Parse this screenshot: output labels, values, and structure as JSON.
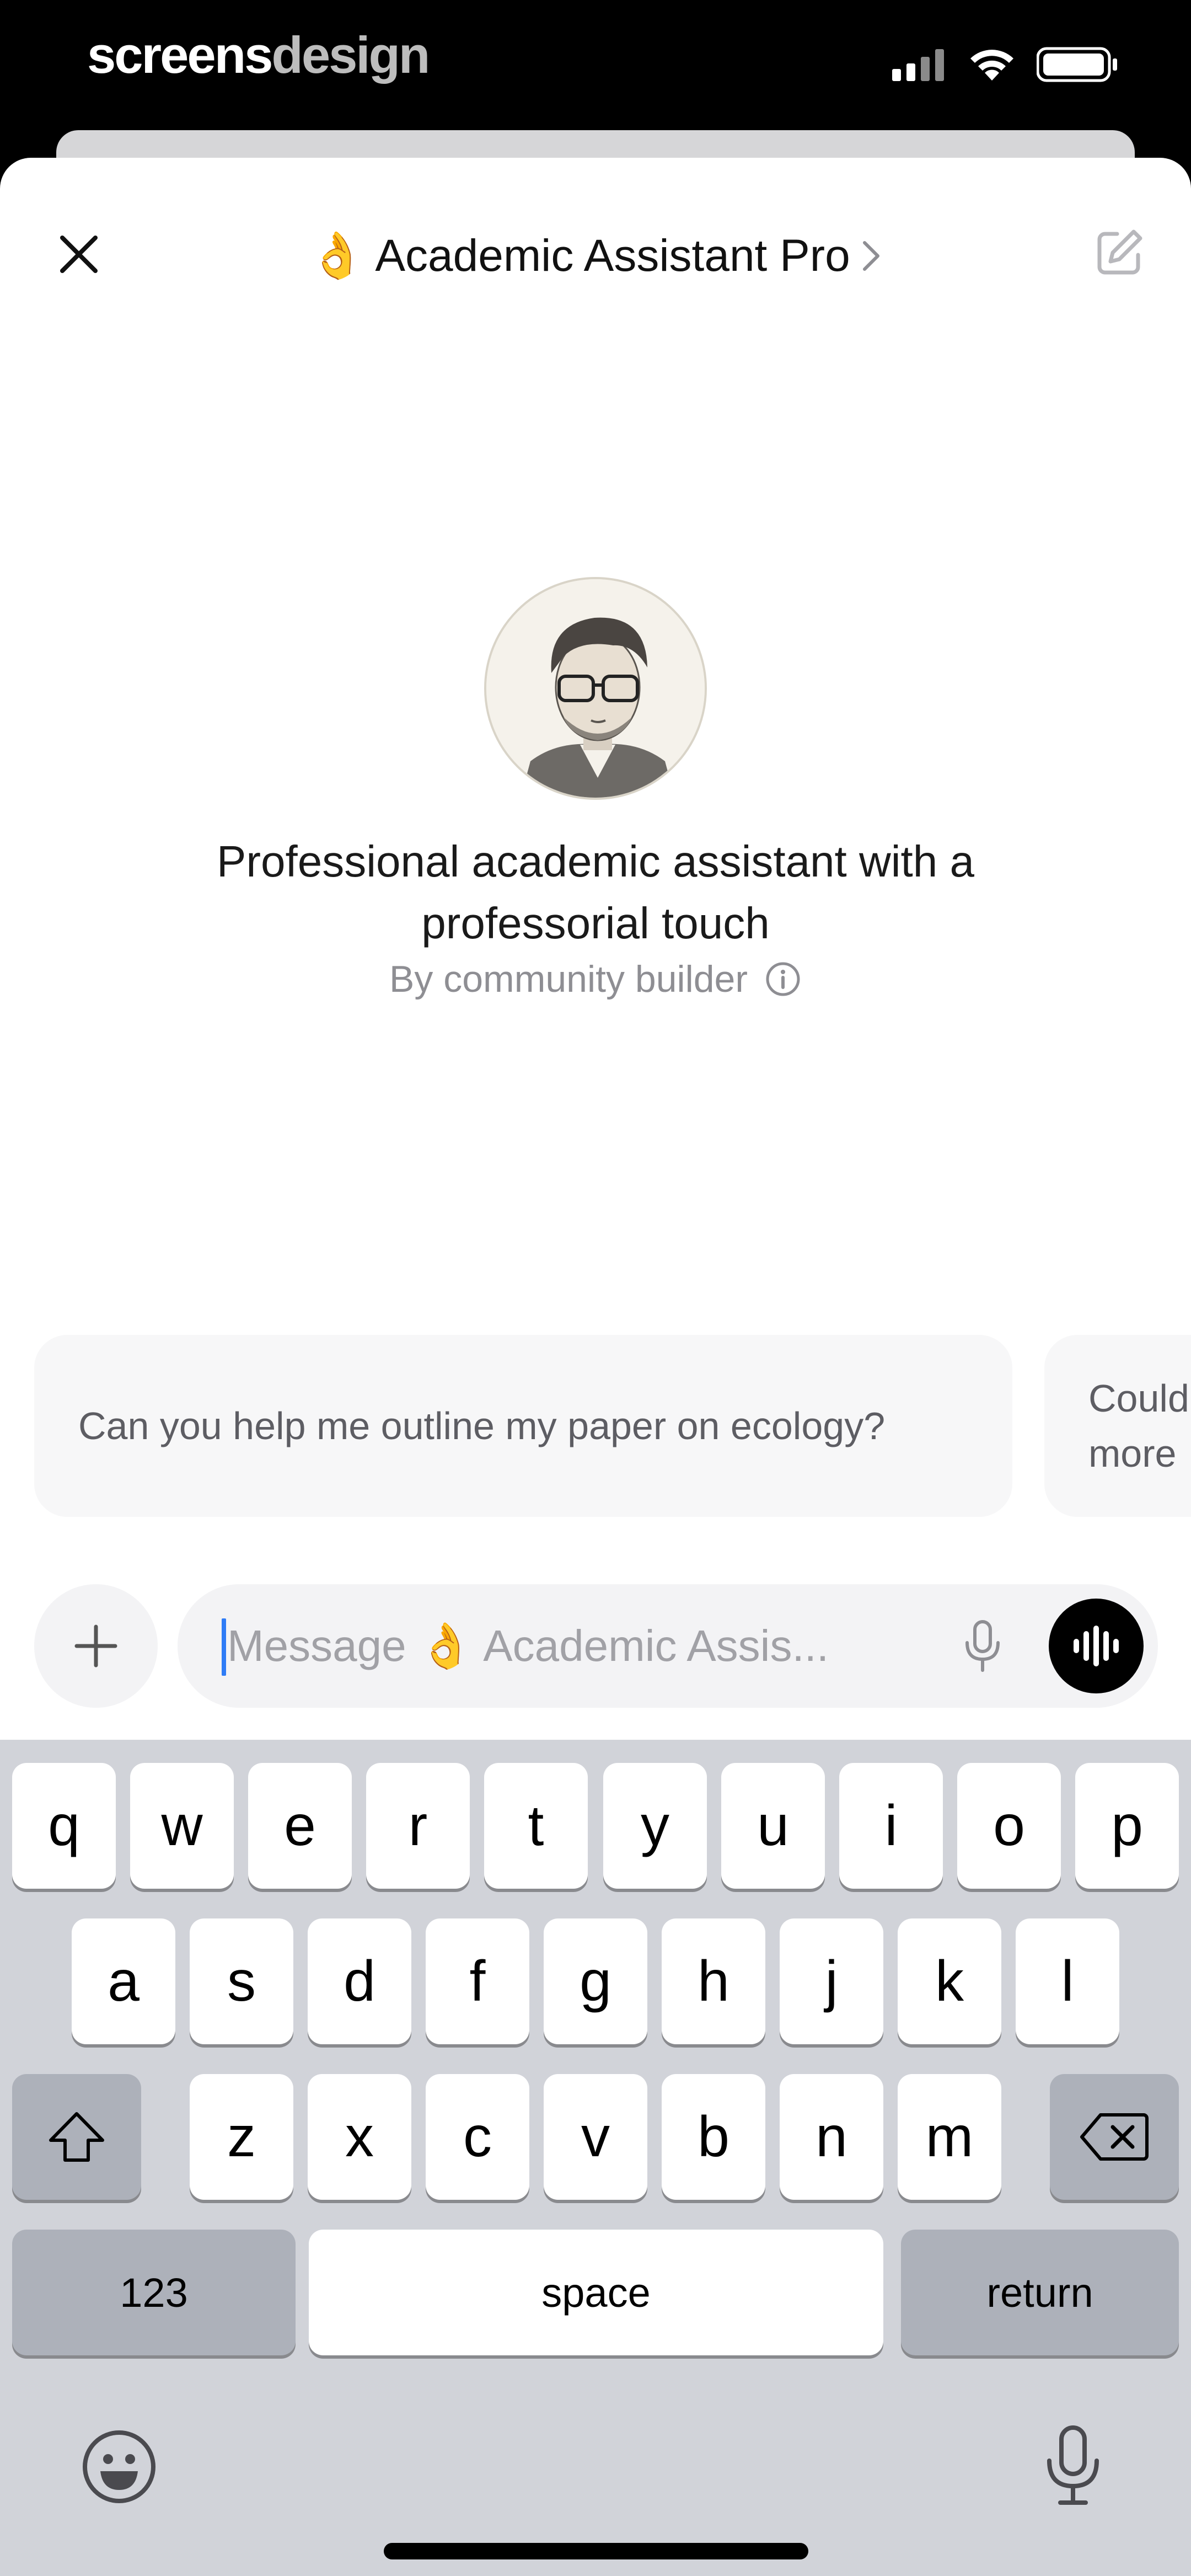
{
  "status_bar": {
    "brand_part1": "screens",
    "brand_part2": "design"
  },
  "header": {
    "emoji": "👌",
    "title": "Academic Assistant Pro",
    "chevron": ">"
  },
  "assistant": {
    "description": "Professional academic assistant with a professorial touch",
    "byline": "By community builder"
  },
  "suggestions": [
    {
      "text": "Can you help me outline my paper on ecology?"
    },
    {
      "text": "Could more"
    }
  ],
  "composer": {
    "placeholder": "Message 👌 Academic Assis..."
  },
  "keyboard": {
    "row1": [
      "q",
      "w",
      "e",
      "r",
      "t",
      "y",
      "u",
      "i",
      "o",
      "p"
    ],
    "row2": [
      "a",
      "s",
      "d",
      "f",
      "g",
      "h",
      "j",
      "k",
      "l"
    ],
    "row3": [
      "z",
      "x",
      "c",
      "v",
      "b",
      "n",
      "m"
    ],
    "numbers_label": "123",
    "space_label": "space",
    "return_label": "return"
  },
  "colors": {
    "accent_caret": "#2f7cf6",
    "keyboard_bg": "#d1d3d9"
  },
  "icons": [
    "close-icon",
    "chevron-right-icon",
    "edit-icon",
    "info-icon",
    "plus-icon",
    "mic-icon",
    "voice-mode-icon",
    "shift-icon",
    "backspace-icon",
    "emoji-icon",
    "keyboard-mic-icon",
    "signal-icon",
    "wifi-icon",
    "battery-icon"
  ]
}
